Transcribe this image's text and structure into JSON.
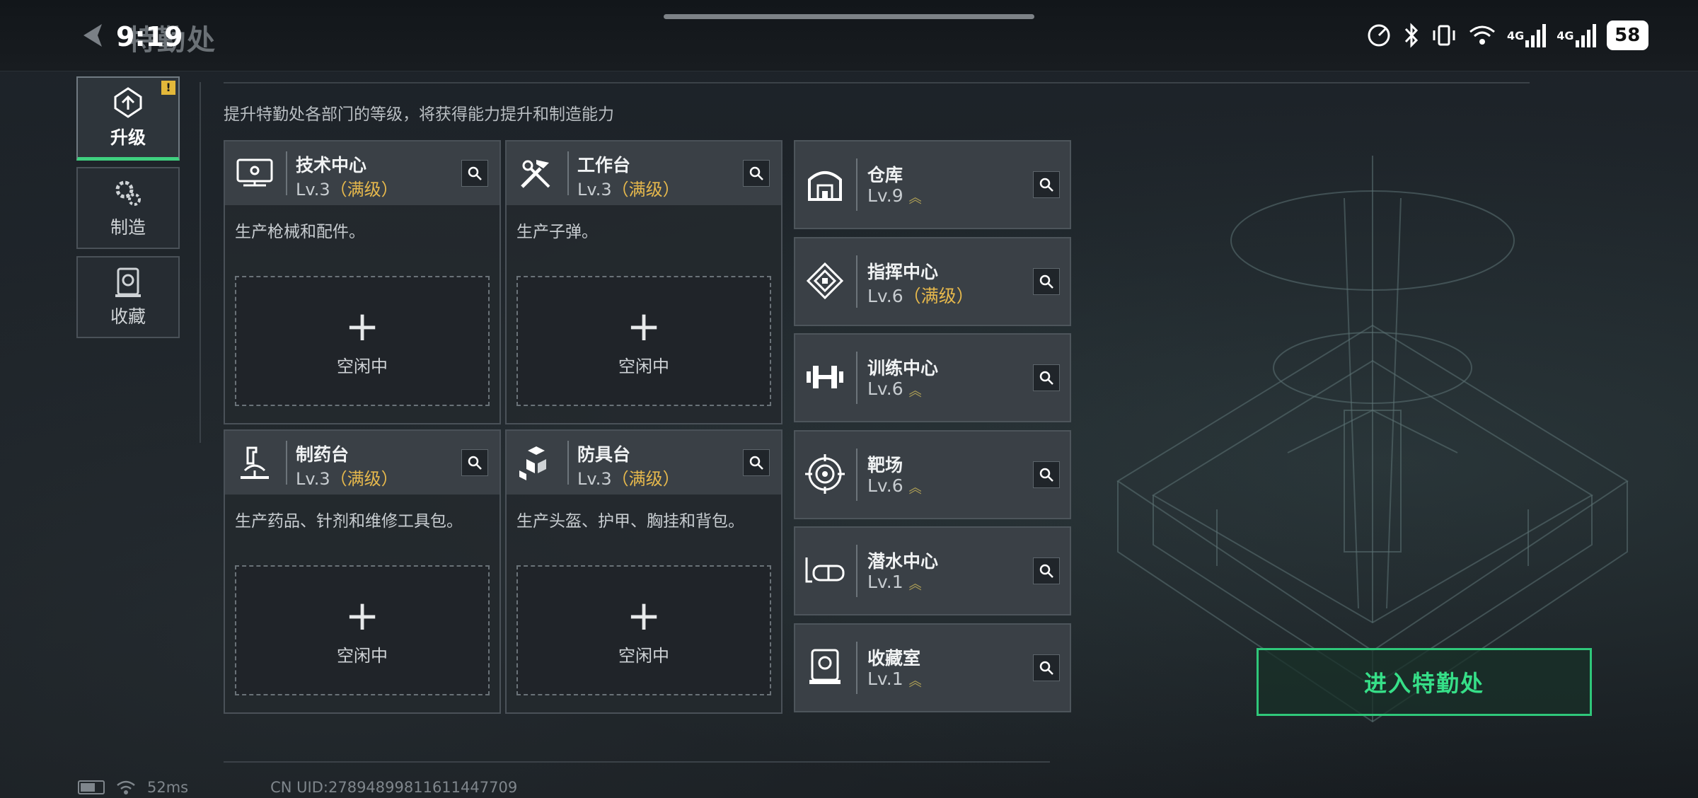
{
  "status_bar": {
    "time": "9:19",
    "battery": "58",
    "network_1": "4G",
    "network_2": "4G"
  },
  "header": {
    "title": "特勤处"
  },
  "sidebar": {
    "items": [
      {
        "label": "升级",
        "icon": "upgrade-icon",
        "active": true,
        "badge": "!"
      },
      {
        "label": "制造",
        "icon": "gears-icon",
        "active": false
      },
      {
        "label": "收藏",
        "icon": "collection-icon",
        "active": false
      }
    ]
  },
  "hint": "提升特勤处各部门的等级，将获得能力提升和制造能力",
  "workshops": [
    {
      "name": "技术中心",
      "level": "Lv.3",
      "max": "（满级）",
      "desc": "生产枪械和配件。",
      "slot": "空闲中",
      "icon": "tech-center-icon"
    },
    {
      "name": "工作台",
      "level": "Lv.3",
      "max": "（满级）",
      "desc": "生产子弹。",
      "slot": "空闲中",
      "icon": "workbench-icon"
    },
    {
      "name": "制药台",
      "level": "Lv.3",
      "max": "（满级）",
      "desc": "生产药品、针剂和维修工具包。",
      "slot": "空闲中",
      "icon": "pharmacy-icon"
    },
    {
      "name": "防具台",
      "level": "Lv.3",
      "max": "（满级）",
      "desc": "生产头盔、护甲、胸挂和背包。",
      "slot": "空闲中",
      "icon": "armor-bench-icon"
    }
  ],
  "facilities": [
    {
      "name": "仓库",
      "level": "Lv.9",
      "max": "",
      "upgradable": true,
      "icon": "warehouse-icon"
    },
    {
      "name": "指挥中心",
      "level": "Lv.6",
      "max": "（满级）",
      "upgradable": false,
      "icon": "command-center-icon"
    },
    {
      "name": "训练中心",
      "level": "Lv.6",
      "max": "",
      "upgradable": true,
      "icon": "training-center-icon"
    },
    {
      "name": "靶场",
      "level": "Lv.6",
      "max": "",
      "upgradable": true,
      "icon": "shooting-range-icon"
    },
    {
      "name": "潜水中心",
      "level": "Lv.1",
      "max": "",
      "upgradable": true,
      "icon": "diving-center-icon"
    },
    {
      "name": "收藏室",
      "level": "Lv.1",
      "max": "",
      "upgradable": true,
      "icon": "collection-room-icon"
    }
  ],
  "enter_button": "进入特勤处",
  "footer": {
    "ping": "52ms",
    "uid": "CN UID:27894899811611447709"
  },
  "colors": {
    "accent_green": "#36df88",
    "max_gold": "#e6b84c",
    "badge_yellow": "#e3b83a"
  }
}
